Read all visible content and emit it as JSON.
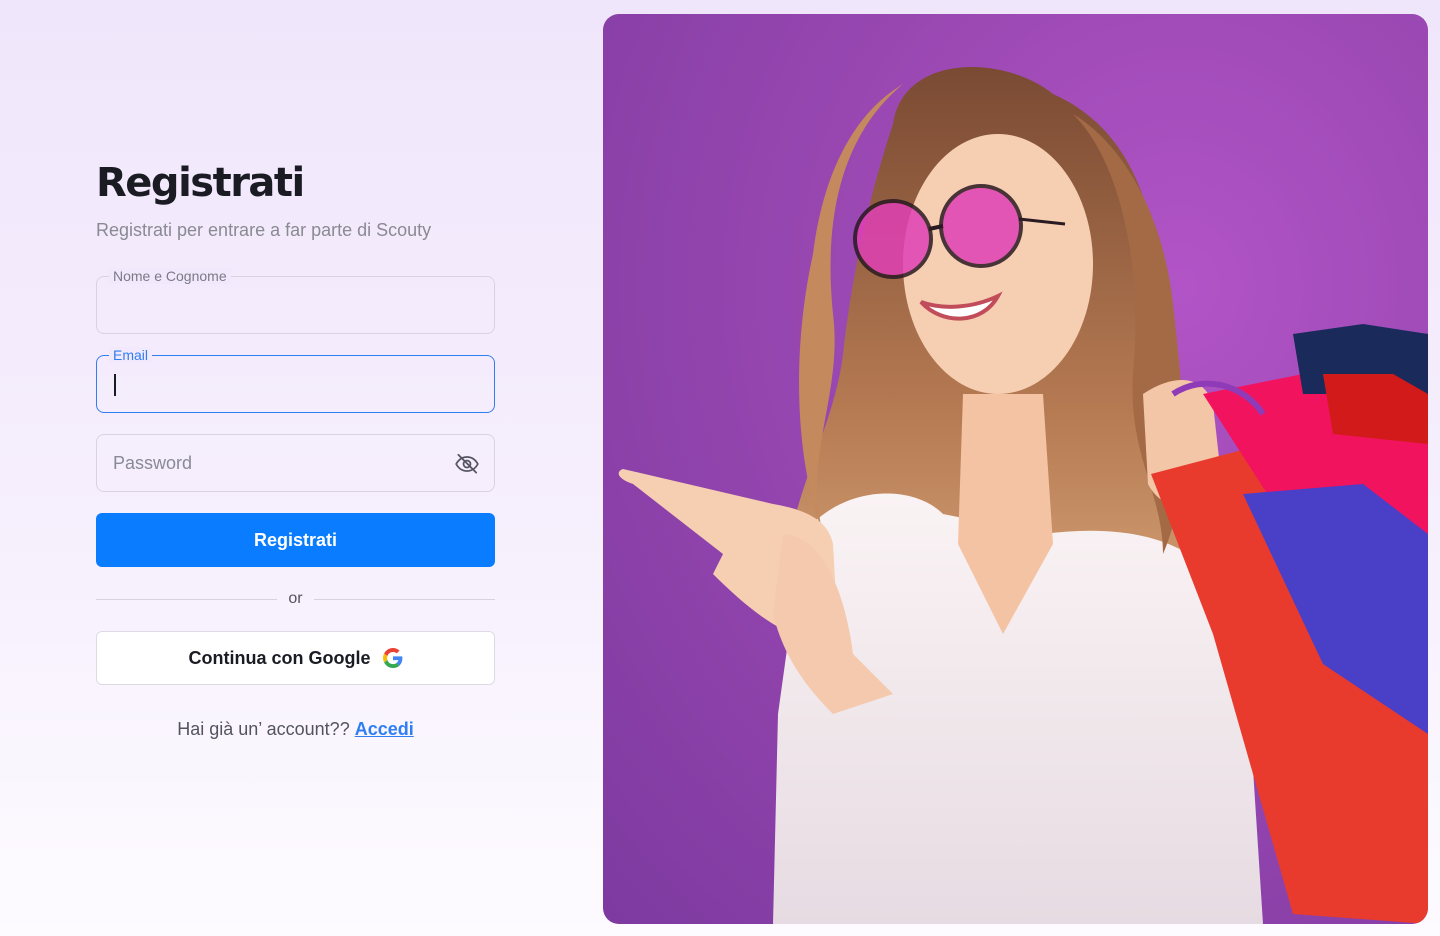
{
  "form": {
    "title": "Registrati",
    "subtitle": "Registrati per entrare a far parte di Scouty",
    "fields": {
      "name": {
        "label": "Nome e Cognome",
        "value": ""
      },
      "email": {
        "label": "Email",
        "value": ""
      },
      "password": {
        "placeholder": "Password",
        "value": ""
      }
    },
    "submit_label": "Registrati",
    "divider_text": "or",
    "google_label": "Continua con Google",
    "login_prompt": "Hai già un’ account??",
    "login_link": "Accedi"
  },
  "icons": {
    "password_toggle": "eye-off-icon",
    "google": "google-g-icon"
  },
  "colors": {
    "primary": "#0A7CFF",
    "focus_border": "#2F7EF3",
    "hero_background": "#9847B1",
    "title_text": "#1B1B24"
  }
}
